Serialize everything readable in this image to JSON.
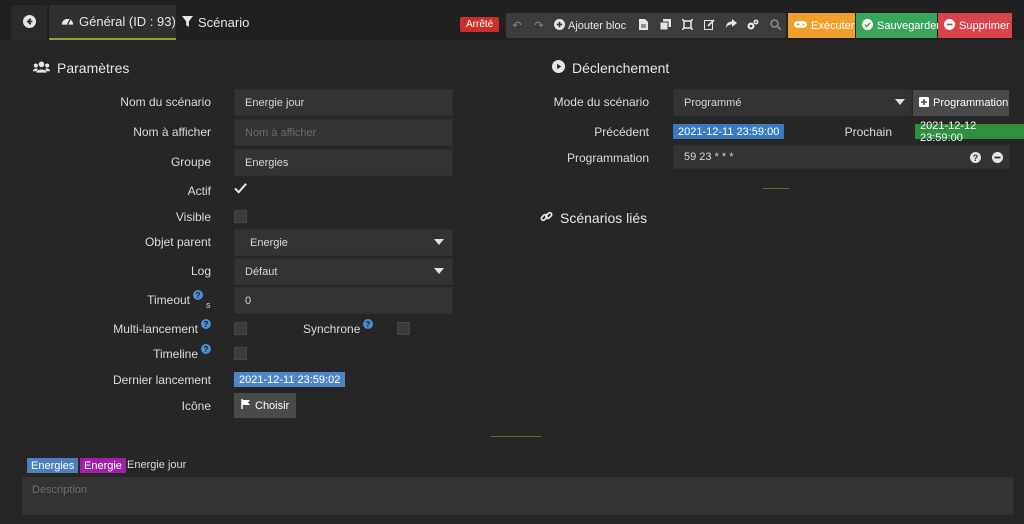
{
  "tabs": {
    "general": "Général (ID : 93)",
    "scenario": "Scénario"
  },
  "state_badge": "Arrêté",
  "toolbar": {
    "add_block": "Ajouter bloc",
    "execute": "Exécuter",
    "save": "Sauvegarder",
    "delete": "Supprimer"
  },
  "params": {
    "heading": "Paramètres",
    "name_label": "Nom du scénario",
    "name_value": "Energie jour",
    "display_label": "Nom à afficher",
    "display_placeholder": "Nom à afficher",
    "group_label": "Groupe",
    "group_value": "Energies",
    "active_label": "Actif",
    "active_checked": true,
    "visible_label": "Visible",
    "visible_checked": false,
    "parent_label": "Objet parent",
    "parent_value": "Energie",
    "log_label": "Log",
    "log_value": "Défaut",
    "timeout_label": "Timeout",
    "timeout_unit": "s",
    "timeout_value": "0",
    "multi_label": "Multi-lancement",
    "multi_checked": false,
    "sync_label": "Synchrone",
    "sync_checked": false,
    "timeline_label": "Timeline",
    "timeline_checked": false,
    "last_run_label": "Dernier lancement",
    "last_run_value": "2021-12-11 23:59:02",
    "icon_label": "Icône",
    "icon_button": "Choisir"
  },
  "trigger": {
    "heading": "Déclenchement",
    "mode_label": "Mode du scénario",
    "mode_value": "Programmé",
    "schedule_button": "Programmation",
    "previous_label": "Précédent",
    "previous_value": "2021-12-11 23:59:00",
    "next_label": "Prochain",
    "next_value": "2021-12-12 23:59:00",
    "cron_label": "Programmation",
    "cron_value": "59 23 * * *"
  },
  "linked": {
    "heading": "Scénarios liés"
  },
  "footer": {
    "tags": [
      {
        "label": "Energies",
        "color": "#4d7fbf"
      },
      {
        "label": "Energie",
        "color": "#a020a8"
      }
    ],
    "name": "Energie jour",
    "description_placeholder": "Description"
  },
  "colors": {
    "accent": "#8ca33a",
    "prev_date": "#3a7bbf",
    "next_date": "#2f8f3f",
    "last_run": "#4e86c8"
  }
}
